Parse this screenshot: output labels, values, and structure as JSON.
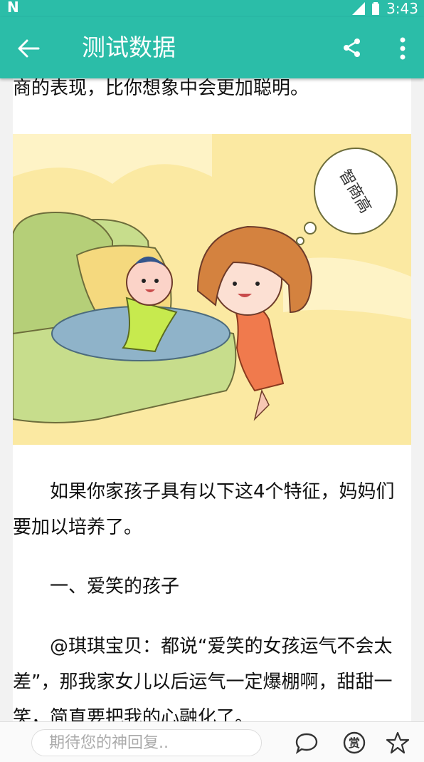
{
  "status_bar": {
    "time": "3:43"
  },
  "app_bar": {
    "title": "测试数据"
  },
  "article": {
    "paragraphs": [
      "商的表现，比你想象中会更加聪明。",
      "　　如果你家孩子具有以下这4个特征，妈妈们要加以培养了。",
      "　　一、爱笑的孩子",
      "　　@琪琪宝贝：都说“爱笑的女孩运气不会太差”，那我家女儿以后运气一定爆棚啊，甜甜一笑，简直要把我的心融化了。"
    ],
    "illustration": {
      "bubble_text": "智商高"
    }
  },
  "bottom_bar": {
    "reply_placeholder": "期待您的神回复..",
    "reward_label": "赏"
  },
  "colors": {
    "accent": "#2bbda8"
  }
}
